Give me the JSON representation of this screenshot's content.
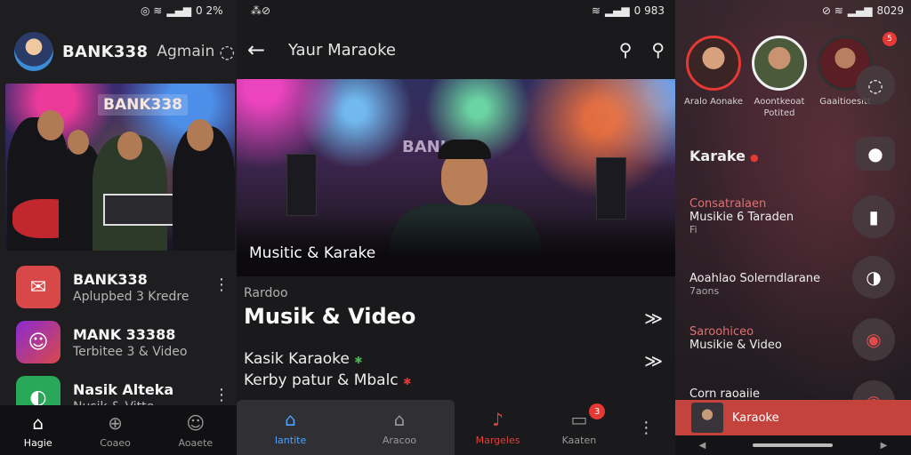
{
  "panel1": {
    "status": "0 2%",
    "header": {
      "title": "BANK338",
      "subtitle": "Agmain",
      "more_icon": "search-icon"
    },
    "hero": {
      "sign": "BANK338"
    },
    "list": [
      {
        "title": "BANK338",
        "subtitle": "Aplupbed 3 Kredre",
        "icon": "bank-icon",
        "color": "#d94848"
      },
      {
        "title": "MANK 33388",
        "subtitle": "Terbitee 3 & Video",
        "icon": "singer-thumb",
        "color": "#6a3aa0"
      },
      {
        "title": "Nasik Alteka",
        "subtitle": "Nusik & Vitte",
        "icon": "chat-icon",
        "color": "#2aa85a"
      }
    ],
    "nav": [
      {
        "label": "Hagie",
        "icon": "home-icon",
        "active": true
      },
      {
        "label": "Coaeo",
        "icon": "search-icon",
        "active": false
      },
      {
        "label": "Aoaete",
        "icon": "profile-icon",
        "active": false
      }
    ]
  },
  "panel2": {
    "status": "0 983",
    "header": {
      "title": "Yaur Maraoke"
    },
    "hero": {
      "sign": "BANK",
      "caption": "Musitic & Karake"
    },
    "section": {
      "label": "Rardoo",
      "title": "Musik & Video"
    },
    "items": [
      {
        "text": "Kasik Karaoke"
      },
      {
        "text": "Kerby patur & Mbalc"
      }
    ],
    "tabs_left": [
      {
        "label": "Iantite",
        "icon": "home-icon"
      },
      {
        "label": "Aracoo",
        "icon": "store-icon"
      }
    ],
    "tabs_right": [
      {
        "label": "Margeles",
        "icon": "music-icon"
      },
      {
        "label": "Kaaten",
        "icon": "inbox-icon",
        "badge": "3"
      }
    ]
  },
  "panel3": {
    "status": "8029",
    "top_badge": "5",
    "stories": [
      {
        "name": "Aralo Aonake"
      },
      {
        "name": "Aoontkeoat Potited"
      },
      {
        "name": "Gaaitioesitt"
      }
    ],
    "items": [
      {
        "l1": "",
        "l2": "Karake",
        "l3": ""
      },
      {
        "l1": "Consatralaen",
        "l2": "Musikie 6 Taraden",
        "l3": "Fi"
      },
      {
        "l1": "",
        "l2": "Aoahlao Solerndlarane",
        "l3": "7aons"
      },
      {
        "l1": "Saroohiceo",
        "l2": "Musikie & Video",
        "l3": ""
      },
      {
        "l1": "",
        "l2": "Corn raoaiie",
        "l3": ""
      }
    ],
    "player": {
      "title": "Karaoke"
    }
  }
}
